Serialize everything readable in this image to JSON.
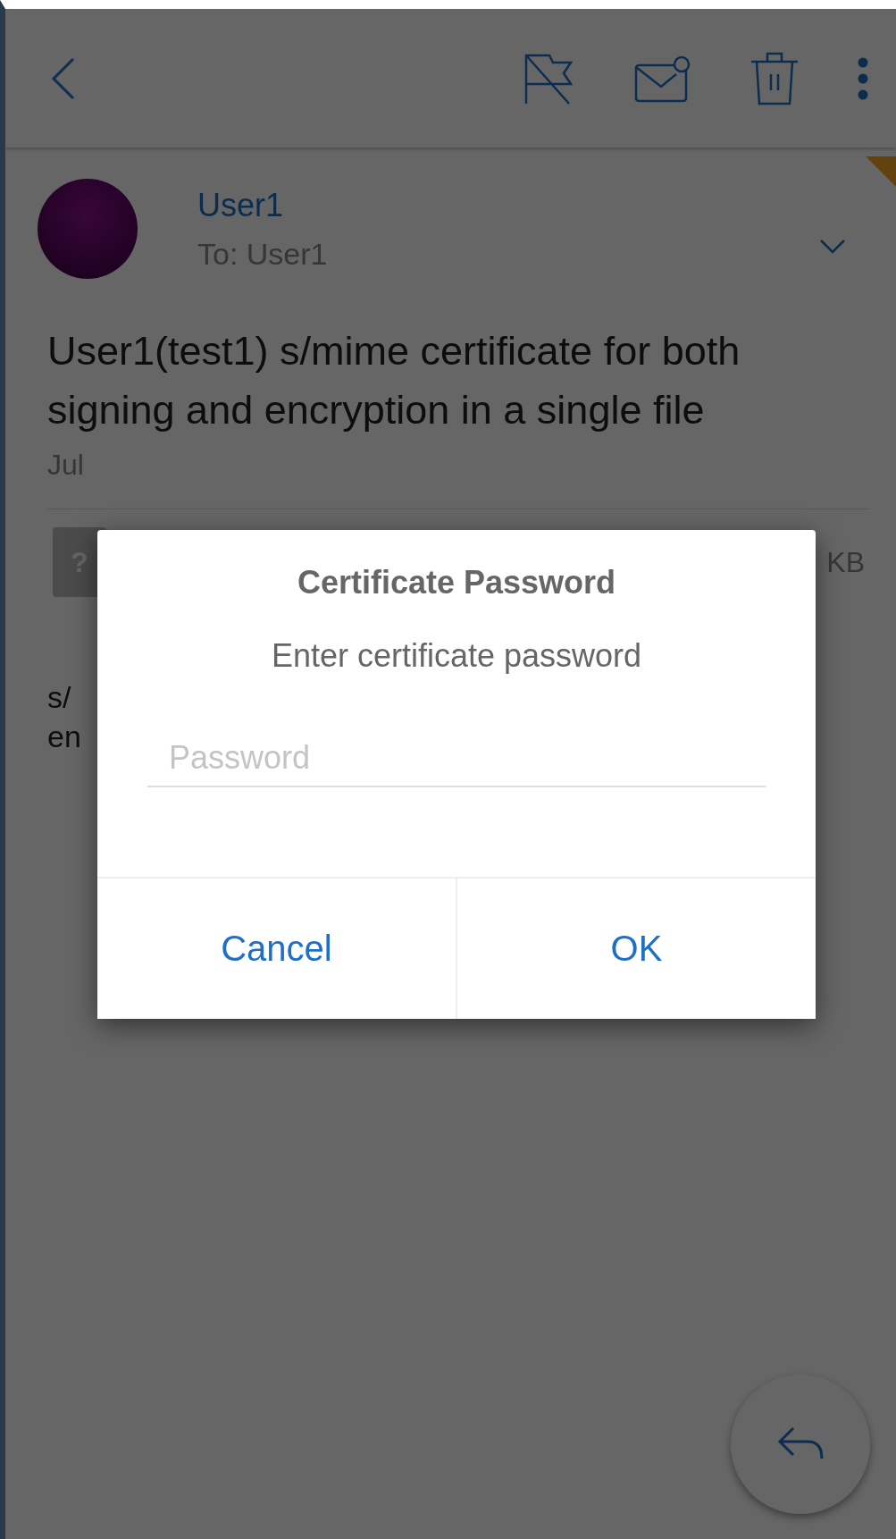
{
  "message": {
    "sender": "User1",
    "recipient": "To: User1",
    "subject": "User1(test1) s/mime certificate for both signing and encryption in a single file",
    "date": "Jul",
    "attachment": {
      "icon": "?",
      "size": "KB"
    },
    "body_lines": [
      "s/",
      "en"
    ]
  },
  "dialog": {
    "title": "Certificate Password",
    "message": "Enter certificate password",
    "field": {
      "placeholder": "Password"
    },
    "buttons": [
      "Cancel",
      "OK"
    ]
  }
}
